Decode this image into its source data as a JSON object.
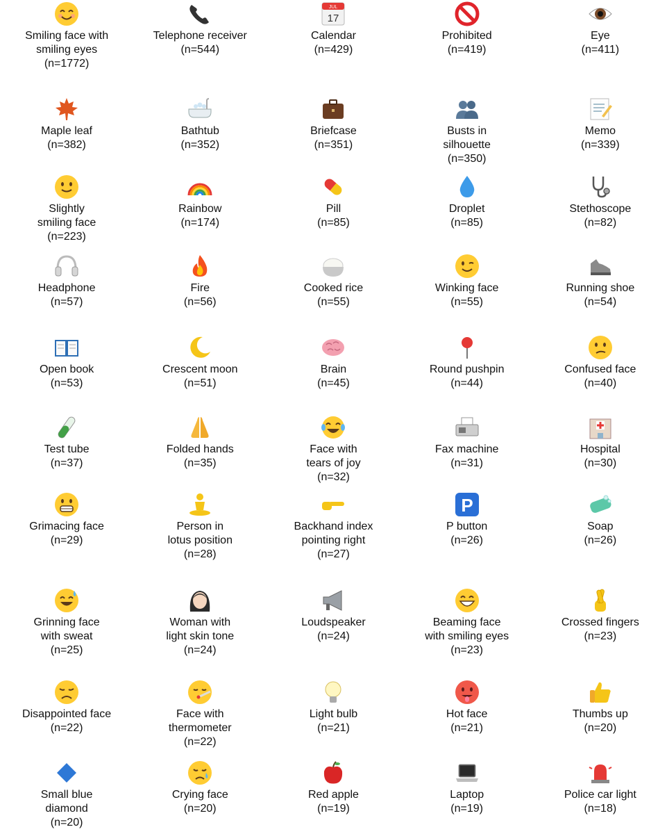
{
  "items": [
    {
      "name": "Smiling face with\nsmiling eyes",
      "count": "(n=1772)",
      "icon": "smiling-face-with-smiling-eyes-icon"
    },
    {
      "name": "Telephone receiver",
      "count": "(n=544)",
      "icon": "telephone-receiver-icon"
    },
    {
      "name": "Calendar",
      "count": "(n=429)",
      "icon": "calendar-icon",
      "icon_text_month": "JUL",
      "icon_text_day": "17"
    },
    {
      "name": "Prohibited",
      "count": "(n=419)",
      "icon": "prohibited-icon"
    },
    {
      "name": "Eye",
      "count": "(n=411)",
      "icon": "eye-icon"
    },
    {
      "name": "Maple leaf",
      "count": "(n=382)",
      "icon": "maple-leaf-icon"
    },
    {
      "name": "Bathtub",
      "count": "(n=352)",
      "icon": "bathtub-icon"
    },
    {
      "name": "Briefcase",
      "count": "(n=351)",
      "icon": "briefcase-icon"
    },
    {
      "name": "Busts in\nsilhouette",
      "count": "(n=350)",
      "icon": "busts-in-silhouette-icon"
    },
    {
      "name": "Memo",
      "count": "(n=339)",
      "icon": "memo-icon"
    },
    {
      "name": "Slightly\nsmiling face",
      "count": "(n=223)",
      "icon": "slightly-smiling-face-icon"
    },
    {
      "name": "Rainbow",
      "count": "(n=174)",
      "icon": "rainbow-icon"
    },
    {
      "name": "Pill",
      "count": "(n=85)",
      "icon": "pill-icon"
    },
    {
      "name": "Droplet",
      "count": "(n=85)",
      "icon": "droplet-icon"
    },
    {
      "name": "Stethoscope",
      "count": "(n=82)",
      "icon": "stethoscope-icon"
    },
    {
      "name": "Headphone",
      "count": "(n=57)",
      "icon": "headphone-icon"
    },
    {
      "name": "Fire",
      "count": "(n=56)",
      "icon": "fire-icon"
    },
    {
      "name": "Cooked rice",
      "count": "(n=55)",
      "icon": "cooked-rice-icon"
    },
    {
      "name": "Winking face",
      "count": "(n=55)",
      "icon": "winking-face-icon"
    },
    {
      "name": "Running shoe",
      "count": "(n=54)",
      "icon": "running-shoe-icon"
    },
    {
      "name": "Open book",
      "count": "(n=53)",
      "icon": "open-book-icon"
    },
    {
      "name": "Crescent moon",
      "count": "(n=51)",
      "icon": "crescent-moon-icon"
    },
    {
      "name": "Brain",
      "count": "(n=45)",
      "icon": "brain-icon"
    },
    {
      "name": "Round pushpin",
      "count": "(n=44)",
      "icon": "round-pushpin-icon"
    },
    {
      "name": "Confused face",
      "count": "(n=40)",
      "icon": "confused-face-icon"
    },
    {
      "name": "Test tube",
      "count": "(n=37)",
      "icon": "test-tube-icon"
    },
    {
      "name": "Folded hands",
      "count": "(n=35)",
      "icon": "folded-hands-icon"
    },
    {
      "name": "Face with\ntears of joy",
      "count": "(n=32)",
      "icon": "face-with-tears-of-joy-icon"
    },
    {
      "name": "Fax machine",
      "count": "(n=31)",
      "icon": "fax-machine-icon"
    },
    {
      "name": "Hospital",
      "count": "(n=30)",
      "icon": "hospital-icon"
    },
    {
      "name": "Grimacing face",
      "count": "(n=29)",
      "icon": "grimacing-face-icon"
    },
    {
      "name": "Person in\nlotus position",
      "count": "(n=28)",
      "icon": "person-in-lotus-position-icon"
    },
    {
      "name": "Backhand index\npointing right",
      "count": "(n=27)",
      "icon": "backhand-index-pointing-right-icon"
    },
    {
      "name": "P button",
      "count": "(n=26)",
      "icon": "p-button-icon",
      "icon_text": "P"
    },
    {
      "name": "Soap",
      "count": "(n=26)",
      "icon": "soap-icon"
    },
    {
      "name": "Grinning face\nwith sweat",
      "count": "(n=25)",
      "icon": "grinning-face-with-sweat-icon"
    },
    {
      "name": "Woman with\nlight skin tone",
      "count": "(n=24)",
      "icon": "woman-light-skin-tone-icon"
    },
    {
      "name": "Loudspeaker",
      "count": "(n=24)",
      "icon": "loudspeaker-icon"
    },
    {
      "name": "Beaming face\nwith smiling eyes",
      "count": "(n=23)",
      "icon": "beaming-face-with-smiling-eyes-icon"
    },
    {
      "name": "Crossed fingers",
      "count": "(n=23)",
      "icon": "crossed-fingers-icon"
    },
    {
      "name": "Disappointed face",
      "count": "(n=22)",
      "icon": "disappointed-face-icon"
    },
    {
      "name": "Face with\nthermometer",
      "count": "(n=22)",
      "icon": "face-with-thermometer-icon"
    },
    {
      "name": "Light bulb",
      "count": "(n=21)",
      "icon": "light-bulb-icon"
    },
    {
      "name": "Hot face",
      "count": "(n=21)",
      "icon": "hot-face-icon"
    },
    {
      "name": "Thumbs up",
      "count": "(n=20)",
      "icon": "thumbs-up-icon"
    },
    {
      "name": "Small blue\ndiamond",
      "count": "(n=20)",
      "icon": "small-blue-diamond-icon"
    },
    {
      "name": "Crying face",
      "count": "(n=20)",
      "icon": "crying-face-icon"
    },
    {
      "name": "Red apple",
      "count": "(n=19)",
      "icon": "red-apple-icon"
    },
    {
      "name": "Laptop",
      "count": "(n=19)",
      "icon": "laptop-icon"
    },
    {
      "name": "Police car light",
      "count": "(n=18)",
      "icon": "police-car-light-icon"
    }
  ]
}
